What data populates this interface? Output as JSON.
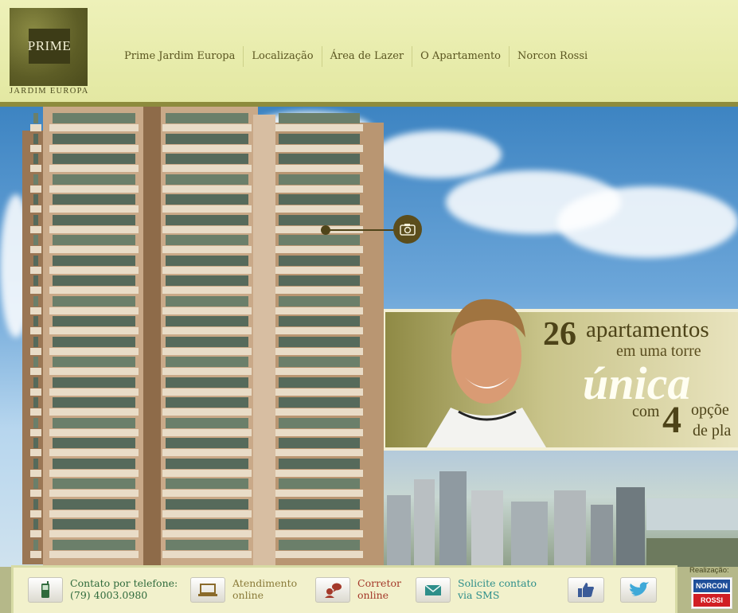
{
  "header": {
    "logo": {
      "word": "PRIME",
      "caption": "JARDIM EUROPA"
    },
    "nav": [
      {
        "label": "Prime Jardim Europa"
      },
      {
        "label": "Localização"
      },
      {
        "label": "Área de Lazer"
      },
      {
        "label": "O Apartamento"
      },
      {
        "label": "Norcon Rossi"
      }
    ]
  },
  "hero": {
    "camera_icon": "camera-icon",
    "promo": {
      "number": "26",
      "line1": "apartamentos",
      "line2": "em uma torre",
      "highlight": "única",
      "line3_prefix": "com",
      "line3_number": "4",
      "line3_suffix": "opçõe",
      "line4": "de pla"
    }
  },
  "footer": {
    "contacts": [
      {
        "icon": "mobile-phone-icon",
        "line1": "Contato por telefone:",
        "line2": "(79) 4003.0980"
      },
      {
        "icon": "laptop-icon",
        "line1": "Atendimento",
        "line2": "online"
      },
      {
        "icon": "broker-chat-icon",
        "line1": "Corretor",
        "line2": "online"
      },
      {
        "icon": "envelope-icon",
        "line1": "Solicite contato",
        "line2": "via SMS"
      }
    ],
    "social": [
      {
        "icon": "facebook-like-icon"
      },
      {
        "icon": "twitter-bird-icon"
      }
    ],
    "realizacao_label": "Realização:",
    "brand": {
      "top": "NORCON",
      "bottom": "ROSSI"
    }
  },
  "colors": {
    "header_bg": "#e3e8a2",
    "header_rule": "#8d8b3d",
    "nav_text": "#5a5520",
    "footer_panel": "#f2f1cc"
  }
}
